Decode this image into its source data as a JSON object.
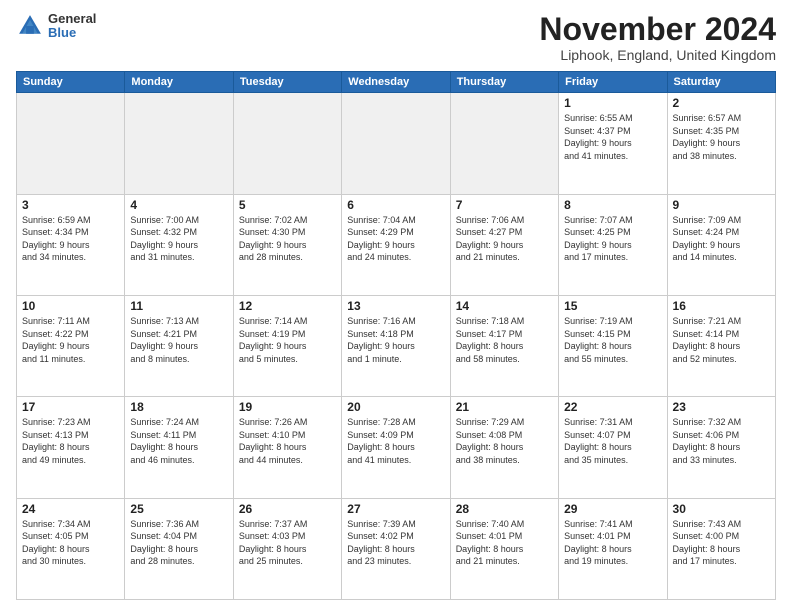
{
  "logo": {
    "general": "General",
    "blue": "Blue"
  },
  "header": {
    "title": "November 2024",
    "location": "Liphook, England, United Kingdom"
  },
  "weekdays": [
    "Sunday",
    "Monday",
    "Tuesday",
    "Wednesday",
    "Thursday",
    "Friday",
    "Saturday"
  ],
  "weeks": [
    [
      {
        "day": "",
        "info": ""
      },
      {
        "day": "",
        "info": ""
      },
      {
        "day": "",
        "info": ""
      },
      {
        "day": "",
        "info": ""
      },
      {
        "day": "",
        "info": ""
      },
      {
        "day": "1",
        "info": "Sunrise: 6:55 AM\nSunset: 4:37 PM\nDaylight: 9 hours\nand 41 minutes."
      },
      {
        "day": "2",
        "info": "Sunrise: 6:57 AM\nSunset: 4:35 PM\nDaylight: 9 hours\nand 38 minutes."
      }
    ],
    [
      {
        "day": "3",
        "info": "Sunrise: 6:59 AM\nSunset: 4:34 PM\nDaylight: 9 hours\nand 34 minutes."
      },
      {
        "day": "4",
        "info": "Sunrise: 7:00 AM\nSunset: 4:32 PM\nDaylight: 9 hours\nand 31 minutes."
      },
      {
        "day": "5",
        "info": "Sunrise: 7:02 AM\nSunset: 4:30 PM\nDaylight: 9 hours\nand 28 minutes."
      },
      {
        "day": "6",
        "info": "Sunrise: 7:04 AM\nSunset: 4:29 PM\nDaylight: 9 hours\nand 24 minutes."
      },
      {
        "day": "7",
        "info": "Sunrise: 7:06 AM\nSunset: 4:27 PM\nDaylight: 9 hours\nand 21 minutes."
      },
      {
        "day": "8",
        "info": "Sunrise: 7:07 AM\nSunset: 4:25 PM\nDaylight: 9 hours\nand 17 minutes."
      },
      {
        "day": "9",
        "info": "Sunrise: 7:09 AM\nSunset: 4:24 PM\nDaylight: 9 hours\nand 14 minutes."
      }
    ],
    [
      {
        "day": "10",
        "info": "Sunrise: 7:11 AM\nSunset: 4:22 PM\nDaylight: 9 hours\nand 11 minutes."
      },
      {
        "day": "11",
        "info": "Sunrise: 7:13 AM\nSunset: 4:21 PM\nDaylight: 9 hours\nand 8 minutes."
      },
      {
        "day": "12",
        "info": "Sunrise: 7:14 AM\nSunset: 4:19 PM\nDaylight: 9 hours\nand 5 minutes."
      },
      {
        "day": "13",
        "info": "Sunrise: 7:16 AM\nSunset: 4:18 PM\nDaylight: 9 hours\nand 1 minute."
      },
      {
        "day": "14",
        "info": "Sunrise: 7:18 AM\nSunset: 4:17 PM\nDaylight: 8 hours\nand 58 minutes."
      },
      {
        "day": "15",
        "info": "Sunrise: 7:19 AM\nSunset: 4:15 PM\nDaylight: 8 hours\nand 55 minutes."
      },
      {
        "day": "16",
        "info": "Sunrise: 7:21 AM\nSunset: 4:14 PM\nDaylight: 8 hours\nand 52 minutes."
      }
    ],
    [
      {
        "day": "17",
        "info": "Sunrise: 7:23 AM\nSunset: 4:13 PM\nDaylight: 8 hours\nand 49 minutes."
      },
      {
        "day": "18",
        "info": "Sunrise: 7:24 AM\nSunset: 4:11 PM\nDaylight: 8 hours\nand 46 minutes."
      },
      {
        "day": "19",
        "info": "Sunrise: 7:26 AM\nSunset: 4:10 PM\nDaylight: 8 hours\nand 44 minutes."
      },
      {
        "day": "20",
        "info": "Sunrise: 7:28 AM\nSunset: 4:09 PM\nDaylight: 8 hours\nand 41 minutes."
      },
      {
        "day": "21",
        "info": "Sunrise: 7:29 AM\nSunset: 4:08 PM\nDaylight: 8 hours\nand 38 minutes."
      },
      {
        "day": "22",
        "info": "Sunrise: 7:31 AM\nSunset: 4:07 PM\nDaylight: 8 hours\nand 35 minutes."
      },
      {
        "day": "23",
        "info": "Sunrise: 7:32 AM\nSunset: 4:06 PM\nDaylight: 8 hours\nand 33 minutes."
      }
    ],
    [
      {
        "day": "24",
        "info": "Sunrise: 7:34 AM\nSunset: 4:05 PM\nDaylight: 8 hours\nand 30 minutes."
      },
      {
        "day": "25",
        "info": "Sunrise: 7:36 AM\nSunset: 4:04 PM\nDaylight: 8 hours\nand 28 minutes."
      },
      {
        "day": "26",
        "info": "Sunrise: 7:37 AM\nSunset: 4:03 PM\nDaylight: 8 hours\nand 25 minutes."
      },
      {
        "day": "27",
        "info": "Sunrise: 7:39 AM\nSunset: 4:02 PM\nDaylight: 8 hours\nand 23 minutes."
      },
      {
        "day": "28",
        "info": "Sunrise: 7:40 AM\nSunset: 4:01 PM\nDaylight: 8 hours\nand 21 minutes."
      },
      {
        "day": "29",
        "info": "Sunrise: 7:41 AM\nSunset: 4:01 PM\nDaylight: 8 hours\nand 19 minutes."
      },
      {
        "day": "30",
        "info": "Sunrise: 7:43 AM\nSunset: 4:00 PM\nDaylight: 8 hours\nand 17 minutes."
      }
    ]
  ]
}
